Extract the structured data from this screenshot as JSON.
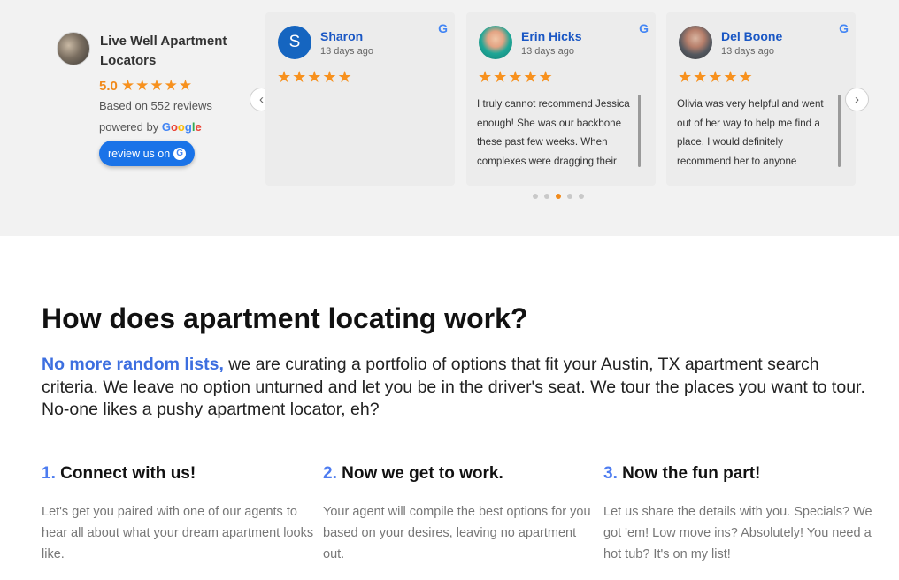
{
  "summary": {
    "business_name": "Live Well Apartment Locators",
    "rating": "5.0",
    "stars": "★★★★★",
    "based_on": "Based on 552 reviews",
    "powered_by": "powered by",
    "google_letters": [
      "G",
      "o",
      "o",
      "g",
      "l",
      "e"
    ],
    "review_button": "review us on",
    "review_button_icon": "G"
  },
  "reviews": [
    {
      "name": "Sharon",
      "date": "13 days ago",
      "initial": "S",
      "stars": "★★★★★",
      "text": "",
      "source_icon": "G"
    },
    {
      "name": "Erin Hicks",
      "date": "13 days ago",
      "initial": "",
      "stars": "★★★★★",
      "text": "I truly cannot recommend Jessica enough! She was our backbone these past few weeks. When complexes were dragging their",
      "source_icon": "G"
    },
    {
      "name": "Del Boone",
      "date": "13 days ago",
      "initial": "",
      "stars": "★★★★★",
      "text": "Olivia was very helpful and went out of her way to help me find a place. I would definitely recommend her to anyone",
      "source_icon": "G"
    }
  ],
  "carousel": {
    "prev_icon": "‹",
    "next_icon": "›",
    "dot_count": 5,
    "active_dot": 2
  },
  "how": {
    "title": "How does apartment locating work?",
    "intro_highlight": "No more random lists,",
    "intro_rest": " we are curating a portfolio of options that fit your Austin, TX apartment search criteria. We leave no option unturned and let you be in the driver's seat. We tour the places you want to tour. No-one likes a pushy apartment locator, eh?"
  },
  "steps": [
    {
      "num": "1.",
      "title": "Connect with us!",
      "text": "Let's get you paired with one of our agents to hear all about what your dream apartment looks like."
    },
    {
      "num": "2.",
      "title": "Now we get to work.",
      "text": "Your agent will compile the best options for you based on your desires, leaving no apartment out."
    },
    {
      "num": "3.",
      "title": "Now the fun part!",
      "text": "Let us share the details with you. Specials? We got 'em! Low move ins? Absolutely! You need a hot tub? It's on my list!"
    }
  ],
  "colors": {
    "star": "#f7911e",
    "link_blue": "#1a57c4",
    "button_blue": "#1a73e8",
    "accent_blue": "#4d7cf0"
  },
  "icons": {
    "google": "google-icon",
    "prev": "chevron-left-icon",
    "next": "chevron-right-icon"
  }
}
